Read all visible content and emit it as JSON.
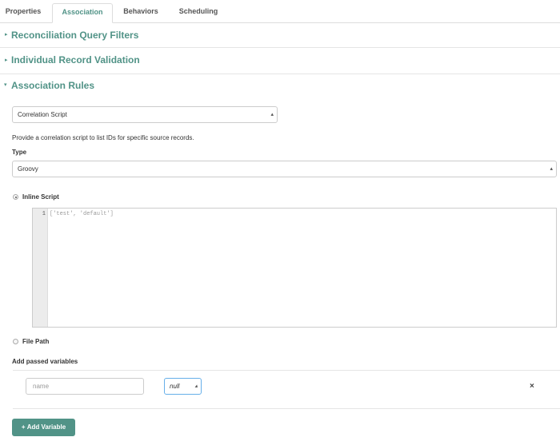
{
  "tabs": [
    {
      "label": "Properties"
    },
    {
      "label": "Association"
    },
    {
      "label": "Behaviors"
    },
    {
      "label": "Scheduling"
    }
  ],
  "sections": {
    "reconciliation": {
      "title": "Reconciliation Query Filters"
    },
    "validation": {
      "title": "Individual Record Validation"
    },
    "association": {
      "title": "Association Rules"
    }
  },
  "association": {
    "rule_select": "Correlation Script",
    "description": "Provide a correlation script to list IDs for specific source records.",
    "type_label": "Type",
    "type_select": "Groovy",
    "inline_label": "Inline Script",
    "editor": {
      "line": "1",
      "code": "['test', 'default']"
    },
    "file_path_label": "File Path",
    "variables_label": "Add passed variables",
    "variable_name_placeholder": "name",
    "variable_value": "null",
    "add_button": "Add Variable",
    "remove_icon": "×"
  },
  "colors": {
    "accent": "#519387"
  },
  "icons": {
    "caret_collapsed": "right-caret-icon",
    "caret_expanded": "down-caret-icon",
    "plus": "plus-icon",
    "remove": "close-icon"
  }
}
